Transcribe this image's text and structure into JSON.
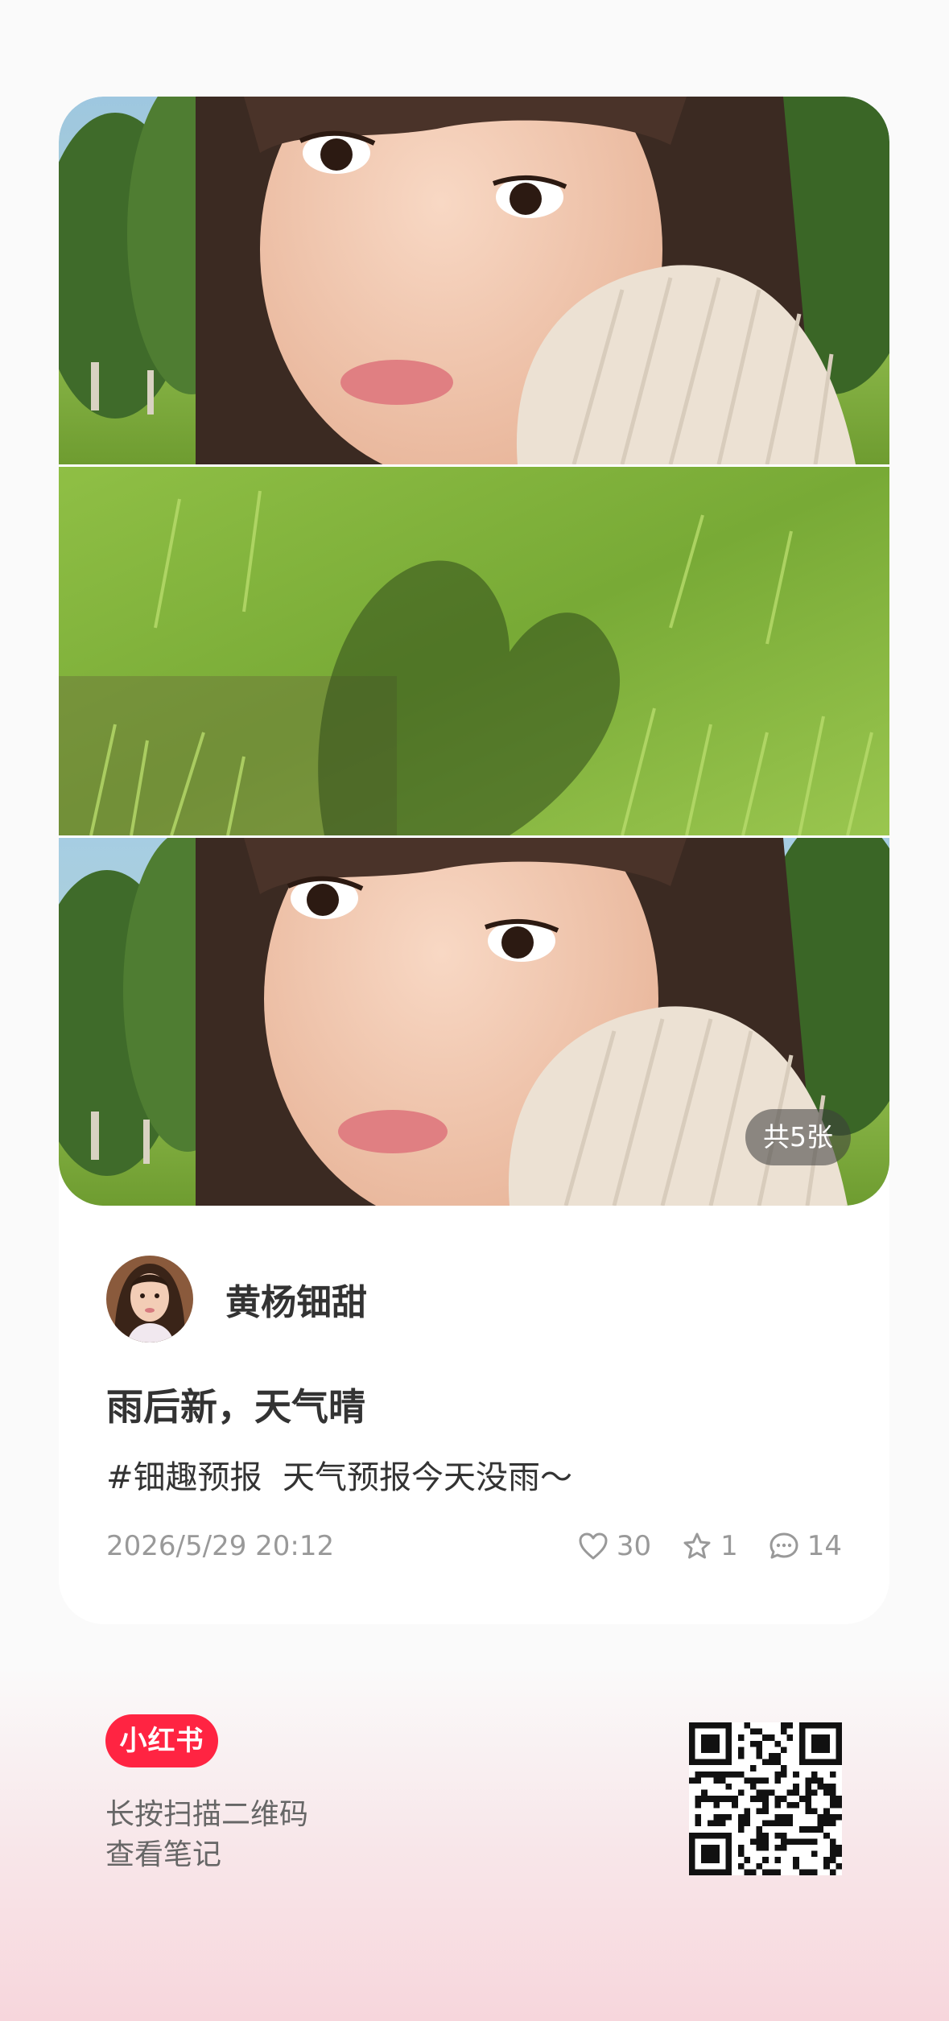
{
  "photo": {
    "count_label": "共5张"
  },
  "author": {
    "name": "黄杨钿甜",
    "avatar_icon": "user-avatar"
  },
  "note": {
    "title": "雨后新，天气晴",
    "description": "#钿趣预报  天气预报今天没雨～",
    "date": "2026/5/29 20:12",
    "likes": "30",
    "collects": "1",
    "comments": "14"
  },
  "footer": {
    "brand": "小红书",
    "scan_line_1": "长按扫描二维码",
    "scan_line_2": "查看笔记",
    "qr_icon": "qr-code"
  },
  "colors": {
    "brand": "#ff2442",
    "text_primary": "#333333",
    "text_secondary": "#999999",
    "background": "#fafafa",
    "background_bottom": "#f7d6dc"
  }
}
